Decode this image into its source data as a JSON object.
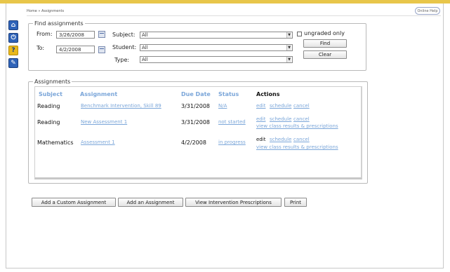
{
  "breadcrumb": "Home » Assignments",
  "online_help": "Online Help",
  "side_icons": [
    {
      "name": "home-icon",
      "glyph": "⌂"
    },
    {
      "name": "power-icon",
      "glyph": "⏻"
    },
    {
      "name": "help-icon",
      "glyph": "?"
    },
    {
      "name": "wrench-icon",
      "glyph": "✎"
    }
  ],
  "find": {
    "legend": "Find assignments",
    "from_label": "From:",
    "from_value": "3/26/2008",
    "to_label": "To:",
    "to_value": "4/2/2008",
    "subject_label": "Subject:",
    "subject_value": "All",
    "student_label": "Student:",
    "student_value": "All",
    "type_label": "Type:",
    "type_value": "All",
    "ungraded_label": "ungraded only",
    "find_button": "Find",
    "clear_button": "Clear"
  },
  "assignments": {
    "legend": "Assignments",
    "headers": {
      "subject": "Subject",
      "assignment": "Assignment",
      "due_date": "Due Date",
      "status": "Status",
      "actions": "Actions"
    },
    "rows": [
      {
        "subject": "Reading",
        "assignment": "Benchmark Intervention, Skill 89",
        "due": "3/31/2008",
        "status": "N/A",
        "action_line1": [
          "edit",
          "schedule",
          "cancel"
        ],
        "action_line2": null,
        "edit_plain": false
      },
      {
        "subject": "Reading",
        "assignment": "New Assessment 1",
        "due": "3/31/2008",
        "status": "not started",
        "action_line1": [
          "edit",
          "schedule",
          "cancel"
        ],
        "action_line2": "view class results & prescriptions",
        "edit_plain": false
      },
      {
        "subject": "Mathematics",
        "assignment": "Assessment 1",
        "due": "4/2/2008",
        "status": "in progress",
        "action_line1": [
          "edit",
          "schedule",
          "cancel"
        ],
        "action_line2": "view class results & prescriptions",
        "edit_plain": true
      }
    ]
  },
  "bottom_buttons": [
    "Add a Custom Assignment",
    "Add an Assignment",
    "View Intervention Prescriptions",
    "Print"
  ]
}
